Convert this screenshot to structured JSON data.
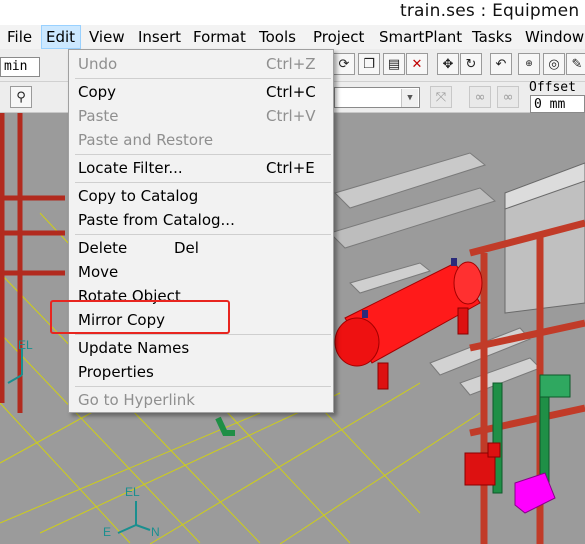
{
  "window": {
    "title": "train.ses : Equipmen"
  },
  "menubar": {
    "items": [
      {
        "label": "File"
      },
      {
        "label": "Edit"
      },
      {
        "label": "View"
      },
      {
        "label": "Insert"
      },
      {
        "label": "Format"
      },
      {
        "label": "Tools"
      },
      {
        "label": "Project"
      },
      {
        "label": "SmartPlant"
      },
      {
        "label": "Tasks"
      },
      {
        "label": "Window"
      }
    ]
  },
  "toolbar": {
    "left_combo_value": "min",
    "offset_label": "Offset",
    "offset_value": "0 mm"
  },
  "edit_menu": {
    "items": [
      {
        "label": "Undo",
        "shortcut": "Ctrl+Z",
        "enabled": false
      },
      {
        "label": "Copy",
        "shortcut": "Ctrl+C",
        "enabled": true
      },
      {
        "label": "Paste",
        "shortcut": "Ctrl+V",
        "enabled": false
      },
      {
        "label": "Paste and Restore",
        "shortcut": "",
        "enabled": false
      },
      {
        "label": "Locate Filter...",
        "shortcut": "Ctrl+E",
        "enabled": true
      },
      {
        "label": "Copy to Catalog",
        "shortcut": "",
        "enabled": true
      },
      {
        "label": "Paste from Catalog...",
        "shortcut": "",
        "enabled": true
      },
      {
        "label": "Delete",
        "shortcut": "Del",
        "enabled": true
      },
      {
        "label": "Move",
        "shortcut": "",
        "enabled": true
      },
      {
        "label": "Rotate Object",
        "shortcut": "",
        "enabled": true
      },
      {
        "label": "Mirror Copy",
        "shortcut": "",
        "enabled": true
      },
      {
        "label": "Update Names",
        "shortcut": "",
        "enabled": true
      },
      {
        "label": "Properties",
        "shortcut": "",
        "enabled": true
      },
      {
        "label": "Go to Hyperlink",
        "shortcut": "",
        "enabled": false
      }
    ]
  },
  "viewport": {
    "axis_labels": {
      "el_left": "EL",
      "el_bottom": "EL",
      "east": "E",
      "north": "N"
    }
  },
  "colors": {
    "menu_highlight": "#cce8ff",
    "annotation_box": "#e8251f",
    "vessel": "#ff1a1a",
    "steel": "#c23a2a",
    "grid": "#d8d800"
  },
  "icons": [
    "undo-icon",
    "copy-icon",
    "paste-icon",
    "delete-icon",
    "move-icon",
    "rotate-icon",
    "zoom-icon",
    "settings-icon"
  ]
}
